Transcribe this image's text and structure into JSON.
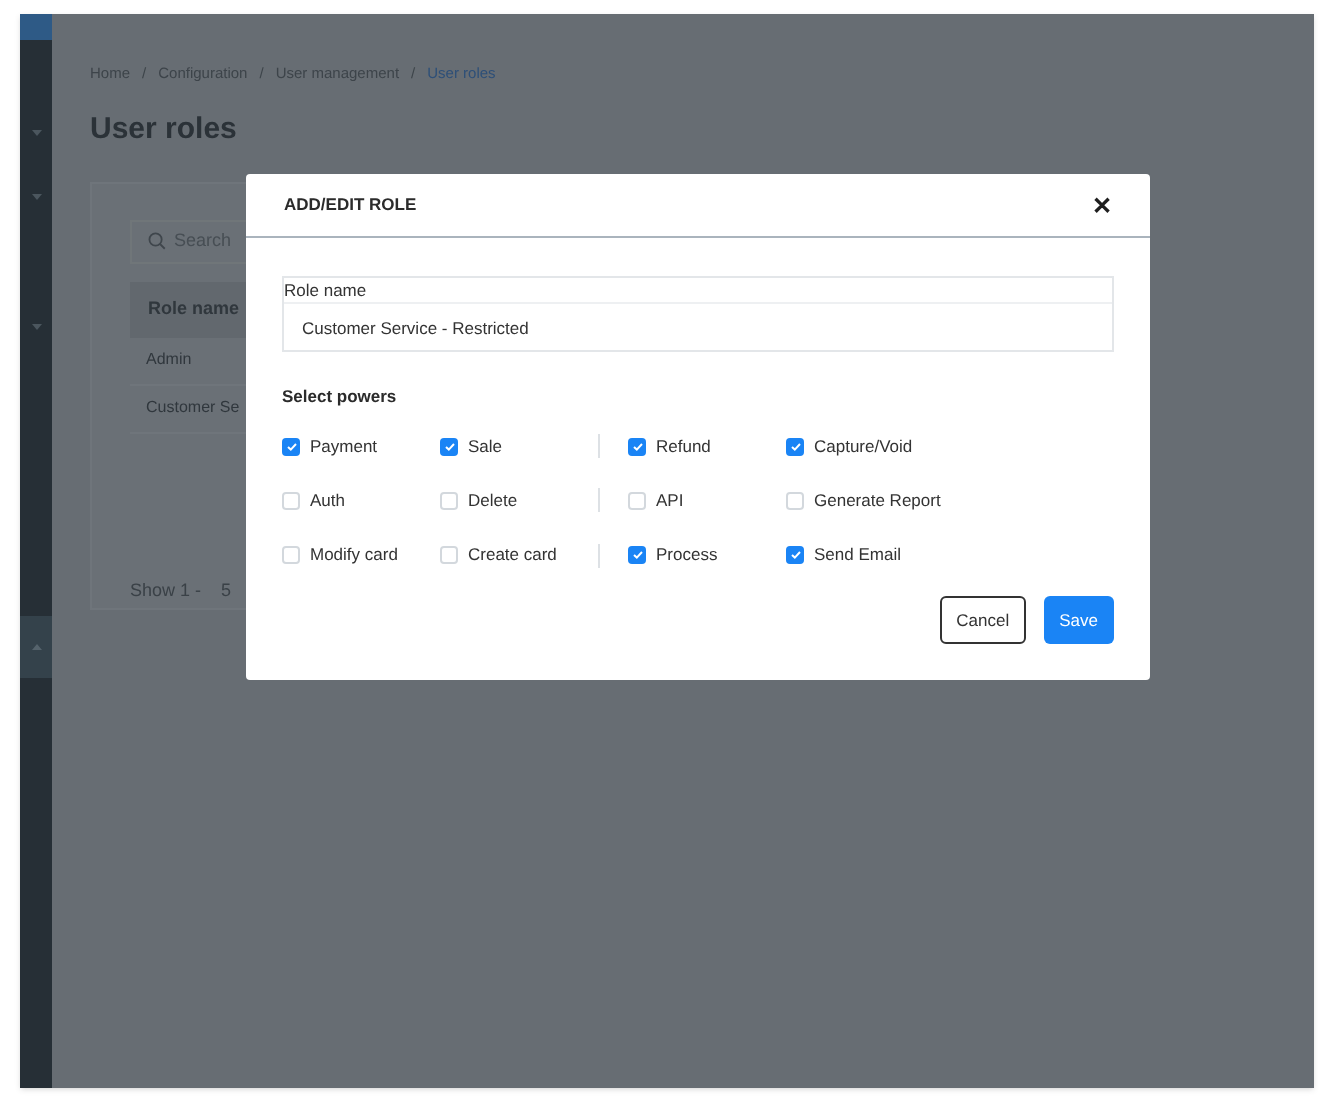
{
  "breadcrumb": [
    {
      "label": "Home",
      "current": false
    },
    {
      "separator": "/"
    },
    {
      "label": "Configuration",
      "current": false
    },
    {
      "separator": "/"
    },
    {
      "label": "User management",
      "current": false
    },
    {
      "separator": "/"
    },
    {
      "label": "User roles",
      "current": true
    }
  ],
  "page_title": "User roles",
  "search": {
    "placeholder": "Search"
  },
  "table": {
    "columns": [
      "Role name"
    ],
    "rows": [
      [
        "Admin"
      ],
      [
        "Customer Se"
      ]
    ]
  },
  "pagination": {
    "label": "Show 1 -",
    "page_size": "5"
  },
  "dialog": {
    "title": "ADD/EDIT ROLE",
    "close": "✕",
    "role_name": {
      "label": "Role name",
      "value": "Customer Service - Restricted"
    },
    "powers_heading": "Select powers",
    "powers": [
      {
        "label": "Payment",
        "checked": true
      },
      {
        "label": "Sale",
        "checked": true
      },
      {
        "label": "Refund",
        "checked": true
      },
      {
        "label": "Capture/Void",
        "checked": true
      },
      {
        "label": "Auth",
        "checked": false
      },
      {
        "label": "Delete",
        "checked": false
      },
      {
        "label": "API",
        "checked": false
      },
      {
        "label": "Generate Report",
        "checked": false
      },
      {
        "label": "Modify card",
        "checked": false
      },
      {
        "label": "Create card",
        "checked": false
      },
      {
        "label": "Process",
        "checked": true
      },
      {
        "label": "Send Email",
        "checked": true
      }
    ],
    "buttons": [
      {
        "label": "Cancel",
        "kind": "secondary"
      },
      {
        "label": "Save",
        "kind": "primary"
      }
    ]
  }
}
